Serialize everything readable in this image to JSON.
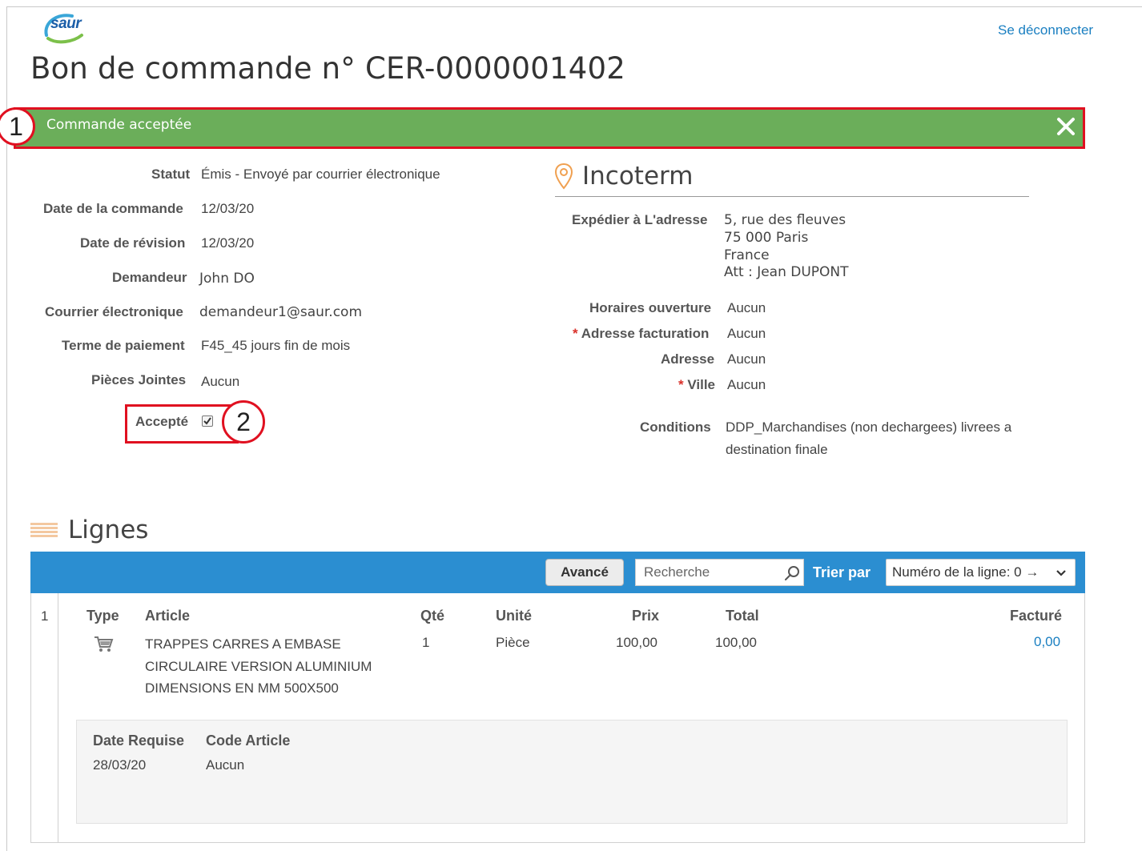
{
  "header": {
    "logo_text": "saur",
    "logout_label": "Se déconnecter",
    "title": "Bon de commande  n° CER-0000001402"
  },
  "banner": {
    "message": "Commande acceptée",
    "callout": "1"
  },
  "order": {
    "statut_label": "Statut",
    "statut_value": "Émis - Envoyé par courrier électronique",
    "date_commande_label": "Date de la commande",
    "date_commande_value": "12/03/20",
    "date_revision_label": "Date de révision",
    "date_revision_value": "12/03/20",
    "demandeur_label": "Demandeur",
    "demandeur_value": "John DO",
    "courrier_label": "Courrier électronique",
    "courrier_value": "demandeur1@saur.com",
    "terme_label": "Terme de paiement",
    "terme_value": "F45_45 jours fin de mois",
    "pieces_label": "Pièces Jointes",
    "pieces_value": "Aucun",
    "accepte_label": "Accepté",
    "accepte_checked": true,
    "callout": "2"
  },
  "incoterm": {
    "title": "Incoterm",
    "expedier_label": "Expédier à L'adresse",
    "address_lines": [
      "5, rue des fleuves",
      "75 000 Paris",
      "France",
      "Att : Jean DUPONT"
    ],
    "horaires_label": "Horaires ouverture",
    "horaires_value": "Aucun",
    "required_mark": "*",
    "adresse_facturation_label": "Adresse facturation",
    "adresse_facturation_value": "Aucun",
    "adresse_label": "Adresse",
    "adresse_value": "Aucun",
    "ville_label": "Ville",
    "ville_value": "Aucun",
    "conditions_label": "Conditions",
    "conditions_line1": "DDP_Marchandises (non dechargees) livrees a",
    "conditions_line2": "destination finale"
  },
  "lignes": {
    "title": "Lignes",
    "toolbar": {
      "advanced_label": "Avancé",
      "search_placeholder": "Recherche",
      "sort_label": "Trier par",
      "sort_value": "Numéro de la ligne: 0 →"
    },
    "columns": {
      "type": "Type",
      "article": "Article",
      "qte": "Qté",
      "unite": "Unité",
      "prix": "Prix",
      "total": "Total",
      "facture": "Facturé"
    },
    "rows": [
      {
        "num": "1",
        "article_lines": [
          "TRAPPES CARRES A EMBASE",
          "CIRCULAIRE VERSION ALUMINIUM",
          "DIMENSIONS EN MM 500X500"
        ],
        "qte": "1",
        "unite": "Pièce",
        "prix": "100,00",
        "total": "100,00",
        "facture": "0,00",
        "detail": {
          "date_requise_label": "Date Requise",
          "date_requise_value": "28/03/20",
          "code_article_label": "Code Article",
          "code_article_value": "Aucun"
        }
      }
    ]
  },
  "colors": {
    "banner_green": "#6bae5a",
    "toolbar_blue": "#2b8ed1",
    "link_blue": "#1a7fc1",
    "callout_red": "#e01020",
    "incoterm_orange": "#f0a050"
  },
  "icons": {
    "logo": "saur-logo-icon",
    "close": "close-icon",
    "location": "map-pin-icon",
    "lines": "lines-stack-icon",
    "search": "search-icon",
    "chevron": "chevron-down-icon",
    "cart": "shopping-cart-icon",
    "checkbox": "checkbox-checked-icon"
  }
}
